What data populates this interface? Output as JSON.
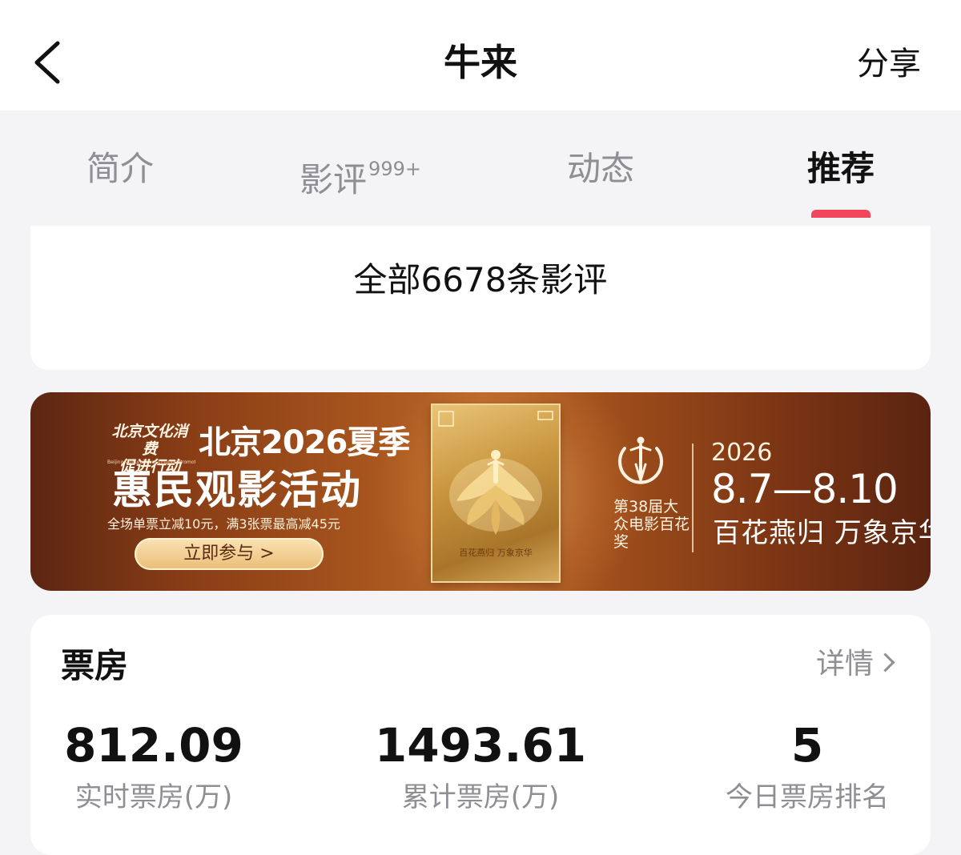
{
  "header": {
    "title": "牛来",
    "share_label": "分享"
  },
  "tabs": [
    {
      "label": "简介",
      "sup": "",
      "active": false
    },
    {
      "label": "影评",
      "sup": "999+",
      "active": false
    },
    {
      "label": "动态",
      "sup": "",
      "active": false
    },
    {
      "label": "推荐",
      "sup": "",
      "active": true
    }
  ],
  "reviews": {
    "link_text": "全部6678条影评"
  },
  "banner": {
    "org_line1": "北京文化消费",
    "org_line2": "促进行动",
    "org_en": "Beijing Cultural Consumption Promotion Action",
    "city_title": "北京2026夏季",
    "main_title": "惠民观影活动",
    "promo": "全场单票立减10元，满3张票最高减45元",
    "cta_label": "立即参与 >",
    "poster_caption": "百花燕归 万象京华",
    "award_name": "第38届大众电影百花奖",
    "year": "2026",
    "dates": "8.7—8.10",
    "slogan": "百花燕归  万象京华"
  },
  "box_office": {
    "title": "票房",
    "details_label": "详情",
    "stats": [
      {
        "value": "812.09",
        "label": "实时票房(万)"
      },
      {
        "value": "1493.61",
        "label": "累计票房(万)"
      },
      {
        "value": "5",
        "label": "今日票房排名"
      }
    ]
  },
  "icons": {
    "back": "chevron-left-icon",
    "details_arrow": "chevron-right-icon",
    "award": "award-emblem-icon"
  },
  "colors": {
    "tab_indicator": "#f0455a",
    "muted_text": "#8e8e93",
    "page_background": "#f4f4f6"
  }
}
